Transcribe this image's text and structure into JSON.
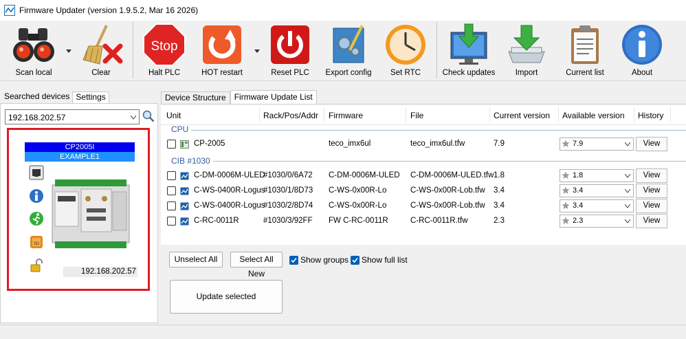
{
  "window": {
    "title": "Firmware Updater (version 1.9.5.2, Mar 16 2026)"
  },
  "toolbar": {
    "scan_local": "Scan local",
    "clear": "Clear",
    "halt_plc": "Halt PLC",
    "stop_sign_text": "Stop",
    "hot_restart": "HOT restart",
    "reset_plc": "Reset PLC",
    "export_config": "Export config",
    "set_rtc": "Set RTC",
    "check_updates": "Check updates",
    "import": "Import",
    "current_list": "Current list",
    "about": "About"
  },
  "left": {
    "tabs": [
      "Searched devices",
      "Settings"
    ],
    "ip_combo_value": "192.168.202.57",
    "device": {
      "name": "CP2005I",
      "label": "EXAMPLE1",
      "ip": "192.168.202.57"
    }
  },
  "right": {
    "tabs": [
      "Device Structure",
      "Firmware Update List"
    ],
    "columns": [
      "Unit",
      "Rack/Pos/Addr",
      "Firmware",
      "File",
      "Current version",
      "Available version",
      "History"
    ],
    "groups": [
      {
        "name": "CPU"
      },
      {
        "name": "CIB #1030"
      }
    ],
    "rows": [
      {
        "unit": "CP-2005",
        "addr": "",
        "firmware": "teco_imx6ul",
        "file": "teco_imx6ul.tfw",
        "current": "7.9",
        "available": "7.9",
        "history": "View"
      },
      {
        "unit": "C-DM-0006M-ULED",
        "addr": "#1030/0/6A72",
        "firmware": "C-DM-0006M-ULED",
        "file": "C-DM-0006M-ULED.tfw",
        "current": "1.8",
        "available": "1.8",
        "history": "View"
      },
      {
        "unit": "C-WS-0400R-Logus",
        "addr": "#1030/1/8D73",
        "firmware": "C-WS-0x00R-Lo",
        "file": "C-WS-0x00R-Lob.tfw",
        "current": "3.4",
        "available": "3.4",
        "history": "View"
      },
      {
        "unit": "C-WS-0400R-Logus",
        "addr": "#1030/2/8D74",
        "firmware": "C-WS-0x00R-Lo",
        "file": "C-WS-0x00R-Lob.tfw",
        "current": "3.4",
        "available": "3.4",
        "history": "View"
      },
      {
        "unit": "C-RC-0011R",
        "addr": "#1030/3/92FF",
        "firmware": "FW C-RC-0011R",
        "file": "C-RC-0011R.tfw",
        "current": "2.3",
        "available": "2.3",
        "history": "View"
      }
    ],
    "unselect_all": "Unselect All",
    "select_all_new": "Select All New",
    "show_groups": "Show groups",
    "show_full_list": "Show full list",
    "show_groups_checked": true,
    "show_full_list_checked": true,
    "update_selected": "Update selected"
  },
  "colors": {
    "highlight_border": "#e01b24",
    "device_name_bg": "#0000ee",
    "device_label_bg": "#1e90ff",
    "checkbox_accent": "#005fb8"
  }
}
